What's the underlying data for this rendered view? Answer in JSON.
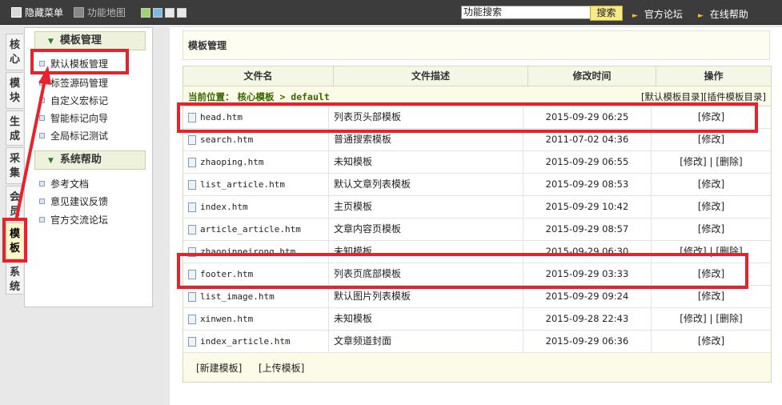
{
  "topbar": {
    "hide_menu": "隐藏菜单",
    "function_map": "功能地图",
    "search_value": "功能搜索",
    "search_button": "搜索",
    "official_forum": "官方论坛",
    "online_help": "在线帮助",
    "swatch_colors": [
      "#9ed46a",
      "#7ab8e6",
      "#e8e8e8",
      "#e8e8e8"
    ]
  },
  "sidebar": {
    "tabs": [
      {
        "label": "核心"
      },
      {
        "label": "模块"
      },
      {
        "label": "生成"
      },
      {
        "label": "采集"
      },
      {
        "label": "会员"
      },
      {
        "label": "模板"
      },
      {
        "label": "系统"
      }
    ],
    "sections": [
      {
        "title": "模板管理",
        "items": [
          {
            "label": "默认模板管理"
          },
          {
            "label": "标签源码管理"
          },
          {
            "label": "自定义宏标记"
          },
          {
            "label": "智能标记向导"
          },
          {
            "label": "全局标记测试"
          }
        ]
      },
      {
        "title": "系统帮助",
        "items": [
          {
            "label": "参考文档"
          },
          {
            "label": "意见建议反馈"
          },
          {
            "label": "官方交流论坛"
          }
        ]
      }
    ]
  },
  "main": {
    "title": "模板管理",
    "table": {
      "headers": [
        "文件名",
        "文件描述",
        "修改时间",
        "操作"
      ],
      "location_label": "当前位置：",
      "location_path": "核心模板 > default",
      "dir_links": "[默认模板目录][插件模板目录]",
      "rows": [
        {
          "file": "head.htm",
          "desc": "列表页头部模板",
          "time": "2015-09-29 06:25",
          "ops": "[修改]"
        },
        {
          "file": "search.htm",
          "desc": "普通搜索模板",
          "time": "2011-07-02 04:36",
          "ops": "[修改]"
        },
        {
          "file": "zhaoping.htm",
          "desc": "未知模板",
          "time": "2015-09-29 06:55",
          "ops": "[修改] | [删除]"
        },
        {
          "file": "list_article.htm",
          "desc": "默认文章列表模板",
          "time": "2015-09-29 08:53",
          "ops": "[修改]"
        },
        {
          "file": "index.htm",
          "desc": "主页模板",
          "time": "2015-09-29 10:42",
          "ops": "[修改]"
        },
        {
          "file": "article_article.htm",
          "desc": "文章内容页模板",
          "time": "2015-09-29 08:57",
          "ops": "[修改]"
        },
        {
          "file": "zhaopinneirong.htm",
          "desc": "未知模板",
          "time": "2015-09-29 06:30",
          "ops": "[修改] | [删除]"
        },
        {
          "file": "footer.htm",
          "desc": "列表页底部模板",
          "time": "2015-09-29 03:33",
          "ops": "[修改]"
        },
        {
          "file": "list_image.htm",
          "desc": "默认图片列表模板",
          "time": "2015-09-29 09:24",
          "ops": "[修改]"
        },
        {
          "file": "xinwen.htm",
          "desc": "未知模板",
          "time": "2015-09-28 22:43",
          "ops": "[修改] | [删除]"
        },
        {
          "file": "index_article.htm",
          "desc": "文章频道封面",
          "time": "2015-09-29 06:36",
          "ops": "[修改]"
        }
      ]
    },
    "bottom": {
      "new_template": "[新建模板]",
      "upload_template": "[上传模板]"
    }
  },
  "annotation_color": "#e8222c"
}
